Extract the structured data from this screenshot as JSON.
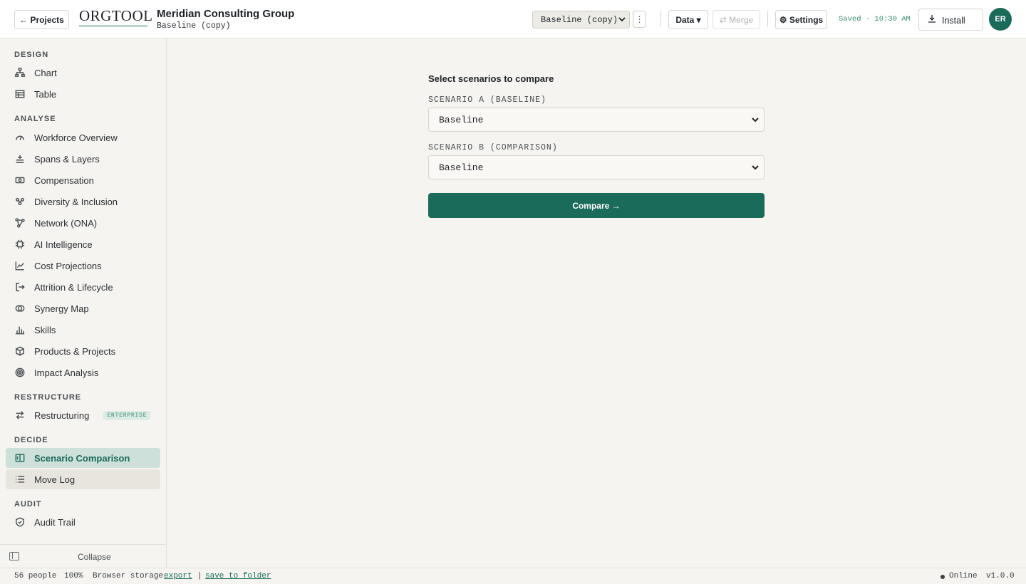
{
  "header": {
    "projects_label": "← Projects",
    "logo": "ORGTOOL",
    "org_name": "Meridian Consulting Group",
    "org_sub": "Baseline (copy)",
    "scenario_value": "Baseline (copy)",
    "data_label": "Data ▾",
    "merge_label": "⇄ Merge",
    "settings_label": "⚙ Settings",
    "saved_text": "Saved · 10:30 AM",
    "install_label": "Install",
    "avatar_initials": "ER"
  },
  "sidebar": {
    "sections": [
      {
        "label": "DESIGN",
        "items": [
          {
            "label": "Chart",
            "icon": "org-chart-icon"
          },
          {
            "label": "Table",
            "icon": "table-icon"
          }
        ]
      },
      {
        "label": "ANALYSE",
        "items": [
          {
            "label": "Workforce Overview",
            "icon": "gauge-icon"
          },
          {
            "label": "Spans & Layers",
            "icon": "layers-icon"
          },
          {
            "label": "Compensation",
            "icon": "banknote-icon"
          },
          {
            "label": "Diversity & Inclusion",
            "icon": "people-icon"
          },
          {
            "label": "Network (ONA)",
            "icon": "network-icon"
          },
          {
            "label": "AI Intelligence",
            "icon": "chip-icon"
          },
          {
            "label": "Cost Projections",
            "icon": "trend-icon"
          },
          {
            "label": "Attrition & Lifecycle",
            "icon": "exit-icon"
          },
          {
            "label": "Synergy Map",
            "icon": "circles-icon"
          },
          {
            "label": "Skills",
            "icon": "bars-icon"
          },
          {
            "label": "Products & Projects",
            "icon": "box-icon"
          },
          {
            "label": "Impact Analysis",
            "icon": "target-icon"
          }
        ]
      },
      {
        "label": "RESTRUCTURE",
        "items": [
          {
            "label": "Restructuring",
            "icon": "arrows-icon",
            "badge": "ENTERPRISE"
          }
        ]
      },
      {
        "label": "DECIDE",
        "items": [
          {
            "label": "Scenario Comparison",
            "icon": "columns-icon"
          },
          {
            "label": "Move Log",
            "icon": "list-icon"
          }
        ]
      },
      {
        "label": "AUDIT",
        "items": [
          {
            "label": "Audit Trail",
            "icon": "shield-icon"
          }
        ]
      }
    ],
    "collapse_label": "Collapse"
  },
  "main": {
    "title": "Select scenarios to compare",
    "scenario_a_label": "SCENARIO A (BASELINE)",
    "scenario_a_value": "Baseline",
    "scenario_b_label": "SCENARIO B (COMPARISON)",
    "scenario_b_value": "Baseline",
    "compare_label": "Compare →"
  },
  "status": {
    "people": "56 people",
    "zoom": "100%",
    "storage": "Browser storage",
    "export_label": "export",
    "separator": "|",
    "save_label": "save to folder",
    "online": "Online",
    "version": "v1.0.0"
  },
  "colors": {
    "accent": "#1a6b5a",
    "active_bg": "#cde0da",
    "background": "#f5f4f0"
  }
}
